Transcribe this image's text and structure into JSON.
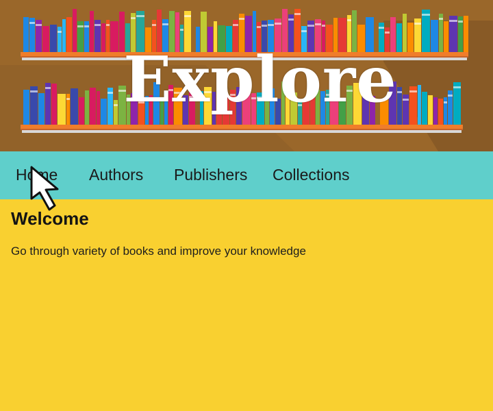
{
  "banner": {
    "title": "Explore"
  },
  "nav": {
    "items": [
      {
        "label": "Home"
      },
      {
        "label": "Authors"
      },
      {
        "label": "Publishers"
      },
      {
        "label": "Collections"
      }
    ]
  },
  "main": {
    "heading": "Welcome",
    "text": "Go through variety of books and improve your knowledge"
  },
  "colors": {
    "banner_bg": "#9a672a",
    "nav_bg": "#5fcfcb",
    "page_bg": "#f9d030",
    "shelf": "#f07d2a"
  }
}
